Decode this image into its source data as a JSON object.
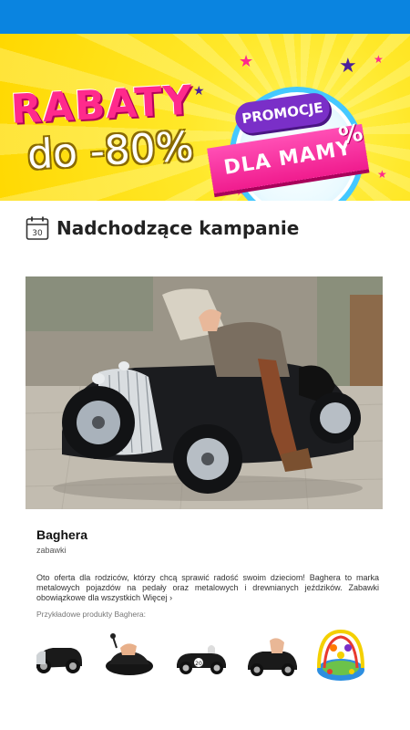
{
  "banner": {
    "headline": "RABATY",
    "discount": "do -80%",
    "badge_top": "PROMOCJE",
    "badge_main": "DLA MAMY",
    "badge_symbol": "%"
  },
  "section": {
    "icon": "calendar-icon",
    "calendar_day": "30",
    "title": "Nadchodzące kampanie"
  },
  "campaign": {
    "name": "Baghera",
    "category": "zabawki",
    "description": "Oto oferta dla rodziców, którzy chcą sprawić radość swoim dzieciom! Baghera to marka metalowych pojazdów na pedały oraz metalowych i drewnianych jeździków. Zabawki obowiązkowe dla wszystkich",
    "more_label": "Więcej",
    "more_icon": "chevron-right-icon",
    "examples_label": "Przykładowe produkty Baghera:",
    "product_badge_number": "20"
  },
  "colors": {
    "status_bar": "#0a84e0",
    "banner_yellow": "#ffe82a",
    "headline_pink": "#ff2a8c",
    "badge_purple": "#7a2fc8"
  }
}
